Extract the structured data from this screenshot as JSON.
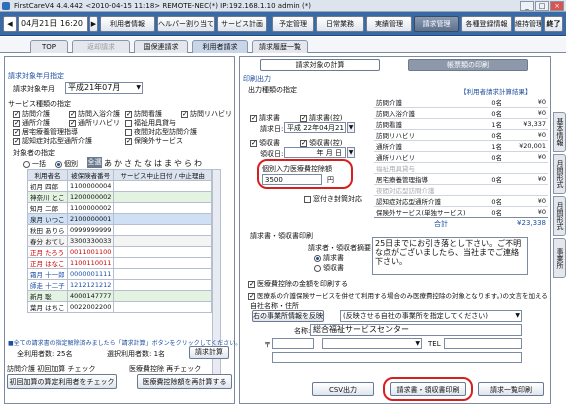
{
  "window": {
    "title": "FirstCareV4 4.4.442 <2010-04-15 11:18> REMOTE-NEC(*) IP:192.168.1.10 admin (*)"
  },
  "toolbar": {
    "date": "04月21日 16:20",
    "items": [
      "利用者情報",
      "ヘルパー割り当て",
      "サービス計画",
      "予定管理",
      "日常業務",
      "実績管理",
      "請求管理",
      "各種登録情報",
      "維持管理",
      "終了"
    ]
  },
  "tabs": [
    "TOP",
    "返却請求",
    "国保連請求",
    "利用者請求",
    "請求履歴一覧"
  ],
  "right_tabs": [
    "基本情報",
    "月間形式",
    "月間形式",
    "事業所"
  ],
  "left": {
    "month_section": "請求対象年月指定",
    "month_label": "請求対象年月",
    "month_value": "平成21年07月",
    "svc_section": "サービス種類の指定",
    "services": [
      {
        "label": "訪問介護",
        "on": true
      },
      {
        "label": "訪問入浴介護",
        "on": true
      },
      {
        "label": "訪問看護",
        "on": true
      },
      {
        "label": "訪問リハビリ",
        "on": true
      },
      {
        "label": "通所介護",
        "on": true
      },
      {
        "label": "通所リハビリ",
        "on": true
      },
      {
        "label": "福祉用具貸与",
        "on": false
      },
      {
        "label": "",
        "on": false
      },
      {
        "label": "居宅療養管理指導",
        "on": true
      },
      {
        "label": "",
        "on": false
      },
      {
        "label": "夜間対応型訪問介護",
        "on": false
      },
      {
        "label": "",
        "on": false
      },
      {
        "label": "認知症対応型通所介護",
        "on": true
      },
      {
        "label": "",
        "on": false
      },
      {
        "label": "保険外サービス",
        "on": true
      },
      {
        "label": "",
        "on": false
      }
    ],
    "target_label": "対象者の指定",
    "radio_all": "一括",
    "radio_individual": "個別",
    "all_button": "全選",
    "kana": [
      "あ",
      "か",
      "さ",
      "た",
      "な",
      "は",
      "ま",
      "や",
      "ら",
      "わ"
    ],
    "columns": [
      "利用者名",
      "被保険者番号",
      "サービス中止日付 / 中止理由"
    ],
    "users": [
      {
        "name": "初月 四郎",
        "no": "1100000004",
        "bg": "#ffffff",
        "color": "#111"
      },
      {
        "name": "神奈川 とこ",
        "no": "1200000002",
        "bg": "#e3f2e1",
        "color": "#111"
      },
      {
        "name": "知月 二郎",
        "no": "1100000002",
        "bg": "#ffffff",
        "color": "#111"
      },
      {
        "name": "泉月 いつこ",
        "no": "2100000001",
        "bg": "#cfe0f5",
        "color": "#111"
      },
      {
        "name": "秋田 ありら",
        "no": "0999999999",
        "bg": "#ffffff",
        "color": "#111"
      },
      {
        "name": "春分 おてし",
        "no": "3300330033",
        "bg": "#f4f4f4",
        "color": "#111"
      },
      {
        "name": "正月 たろう",
        "no": "0011001100",
        "bg": "#ffffff",
        "color": "#cc0000"
      },
      {
        "name": "正月 はなこ",
        "no": "1100110011",
        "bg": "#ffffff",
        "color": "#cc0000"
      },
      {
        "name": "霜月 十一郎",
        "no": "0000001111",
        "bg": "#ffffff",
        "color": "#1c4fa0"
      },
      {
        "name": "師走 十二子",
        "no": "1212121212",
        "bg": "#ffffff",
        "color": "#1c4fa0"
      },
      {
        "name": "新月 聡",
        "no": "4000147777",
        "bg": "#e3f2e1",
        "color": "#111"
      },
      {
        "name": "葉月 はちこ",
        "no": "0022002200",
        "bg": "#ffffff",
        "color": "#111"
      }
    ],
    "note": "■全ての請求書の指定解除済みましたら「請求計算」ボタンをクリックしてください。",
    "total_label": "全利用者数:",
    "total_value": "25名",
    "selected_label": "選択利用者数:",
    "selected_value": "1名",
    "calc_button": "請求計算",
    "bottom_label_a": "訪問介護 初回加算 チェック",
    "bottom_label_b": "医療費控除 再チェック",
    "first_check_button": "初回加算の算定利用者をチェック",
    "recalc_button": "医療費控除額を再計算する"
  },
  "right": {
    "tab_calc": "請求対象の計算",
    "tab_print": "帳票類の印刷",
    "print_section": "印刷出力",
    "type_label": "出力種類の指定",
    "result_label": "【利用者請求計算結果】",
    "docs": [
      {
        "label": "請求書",
        "on": true
      },
      {
        "label": "請求書(控)",
        "on": true
      },
      {
        "label": "領収書",
        "on": true
      },
      {
        "label": "領収書(控)",
        "on": true
      }
    ],
    "claim_date_label": "請求日:",
    "claim_date_value": "平成 22年04月21日",
    "receipt_date_label": "領収日:",
    "receipt_date_value": "年 月 日",
    "medical_label": "個別入力医療費控除額",
    "medical_value": "3500",
    "yen": "円",
    "window_envelope": "窓付き封筒対応",
    "summary": [
      {
        "label": "訪問介護",
        "count": "0名",
        "amount": "¥0"
      },
      {
        "label": "訪問入浴介護",
        "count": "0名",
        "amount": "¥0"
      },
      {
        "label": "訪問看護",
        "count": "1名",
        "amount": "¥3,337"
      },
      {
        "label": "訪問リハビリ",
        "count": "0名",
        "amount": "¥0"
      },
      {
        "label": "通所介護",
        "count": "1名",
        "amount": "¥20,001"
      },
      {
        "label": "通所リハビリ",
        "count": "0名",
        "amount": "¥0"
      },
      {
        "label": "福祉用具貸与",
        "count": "",
        "amount": ""
      },
      {
        "label": "居宅療養管理指導",
        "count": "0名",
        "amount": "¥0"
      },
      {
        "label": "夜間対応型訪問介護",
        "count": "",
        "amount": ""
      },
      {
        "label": "認知症対応型通所介護",
        "count": "0名",
        "amount": "¥0"
      },
      {
        "label": "保険外サービス(単独サービス)",
        "count": "0名",
        "amount": "¥0"
      }
    ],
    "total_label": "合計",
    "total_amount": "¥23,338",
    "message_section": "請求書・領収書印刷",
    "message_label": "請求者・領収者摘要:",
    "radio_claim": "請求書",
    "radio_receipt": "領収書",
    "message_text": "25日までにお引き落とし下さい。ご不明な点がございましたら、当社までご連絡下さい。",
    "medical_print": "医療費控除の金額を印刷する",
    "medical_note": "医療系の介護保険サービスを併せて利用する場合のみ医療費控除の対象となります。)の文言を加える",
    "sender_section": "自社名称・住所",
    "sender_button": "右の事業所情報を反映",
    "sender_select": "(反映させる自社の事業所を指定してください)",
    "name_label": "名称:",
    "name_value": "総合福祉サービスセンター",
    "postal_label": "〒",
    "tel_label": "TEL",
    "csv_button": "CSV出力",
    "print_button": "請求書・領収書印刷",
    "list_button": "請求一覧印刷"
  }
}
